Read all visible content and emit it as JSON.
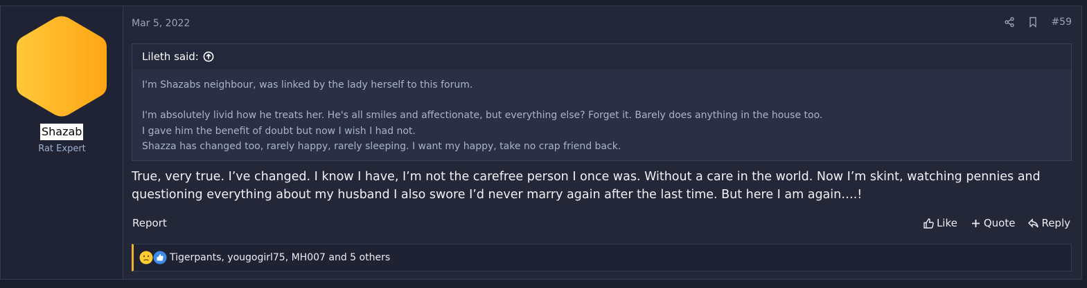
{
  "post": {
    "date": "Mar 5, 2022",
    "number": "#59",
    "user": {
      "name": "Shazab",
      "title": "Rat Expert"
    },
    "quote": {
      "author": "Lileth said:",
      "lines": [
        "I'm Shazabs neighbour, was linked by the lady herself to this forum.",
        "",
        "I'm absolutely livid how he treats her. He's all smiles and affectionate, but everything else? Forget it. Barely does anything in the house too.",
        "I gave him the benefit of doubt but now I wish I had not.",
        "Shazza has changed too, rarely happy, rarely sleeping. I want my happy, take no crap friend back."
      ]
    },
    "message": "True, very true. I’ve changed. I know I have, I’m not the carefree person I once was. Without a care in the world. Now I’m skint, watching pennies and questioning everything about my husband I also swore I’d never marry again after the last time. But here I am again….!",
    "actions": {
      "report": "Report",
      "like": "Like",
      "quote": "Quote",
      "reply": "Reply"
    },
    "reactions": {
      "text": "Tigerpants, yougogirl75, MH007 and 5 others"
    },
    "colors": {
      "avatar": "#ffb21f",
      "reaction_border": "#f0b030",
      "background": "#232738"
    }
  }
}
